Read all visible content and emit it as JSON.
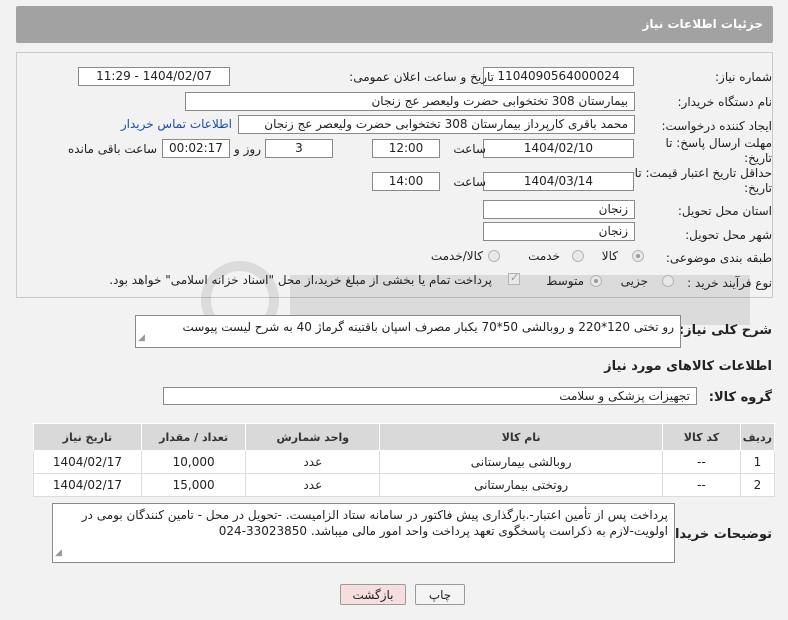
{
  "header": {
    "title": "جزئیات اطلاعات نیاز"
  },
  "form": {
    "need_number_label": "شماره نیاز:",
    "need_number": "1104090564000024",
    "announce_label": "تاریخ و ساعت اعلان عمومی:",
    "announce_value": "1404/02/07 - 11:29",
    "buyer_org_label": "نام دستگاه خریدار:",
    "buyer_org": "بیمارستان 308 تختخوابی حضرت ولیعصر عج  زنجان",
    "creator_label": "ایجاد کننده درخواست:",
    "creator": "محمد باقری کارپرداز بیمارستان 308 تختخوابی حضرت ولیعصر عج  زنجان",
    "contact_link": "اطلاعات تماس خریدار",
    "reply_deadline_label": "مهلت ارسال پاسخ: تا تاریخ:",
    "reply_date": "1404/02/10",
    "time_label": "ساعت",
    "reply_time": "12:00",
    "days": "3",
    "days_label": "روز و",
    "remaining": "00:02:17",
    "remaining_label": "ساعت باقی مانده",
    "price_deadline_label": "حداقل تاریخ اعتبار قیمت: تا تاریخ:",
    "price_date": "1404/03/14",
    "price_time": "14:00",
    "province_label": "استان محل تحویل:",
    "province": "زنجان",
    "city_label": "شهر محل تحویل:",
    "city": "زنجان",
    "category_label": "طبقه بندی موضوعی:",
    "category_options": [
      "کالا",
      "خدمت",
      "کالا/خدمت"
    ],
    "purchase_type_label": "نوع فرآیند خرید :",
    "purchase_options": [
      "جزیی",
      "متوسط"
    ],
    "payment_note": "پرداخت تمام یا بخشی از مبلغ خرید،از محل \"اسناد خزانه اسلامی\" خواهد بود."
  },
  "description": {
    "label": "شرح کلی نیاز:",
    "text": "رو تختی 120*220 و روبالشی 50*70 یکبار مصرف اسپان باقتینه گرماژ 40 به شرح لیست پیوست"
  },
  "goods": {
    "section_title": "اطلاعات کالاهای مورد نیاز",
    "group_label": "گروه کالا:",
    "group_value": "تجهیزات پزشکی و سلامت",
    "columns": [
      "ردیف",
      "کد کالا",
      "نام کالا",
      "واحد شمارش",
      "تعداد / مقدار",
      "تاریخ نیاز"
    ],
    "rows": [
      {
        "idx": "1",
        "code": "--",
        "name": "روبالشی بیمارستانی",
        "unit": "عدد",
        "qty": "10,000",
        "date": "1404/02/17"
      },
      {
        "idx": "2",
        "code": "--",
        "name": "روتختی بیمارستانی",
        "unit": "عدد",
        "qty": "15,000",
        "date": "1404/02/17"
      }
    ]
  },
  "buyer_notes": {
    "label": "توضیحات خریدار:",
    "text": "پرداخت پس از تأمین اعتبار-.بارگذاری پیش فاکتور در سامانه ستاد الزامیست. -تحویل در محل - تامین کنندگان بومی در اولویت-لازم به ذکراست پاسخگوی تعهد پرداخت واحد امور مالی میباشد. 33023850-024"
  },
  "buttons": {
    "print": "چاپ",
    "back": "بازگشت"
  }
}
